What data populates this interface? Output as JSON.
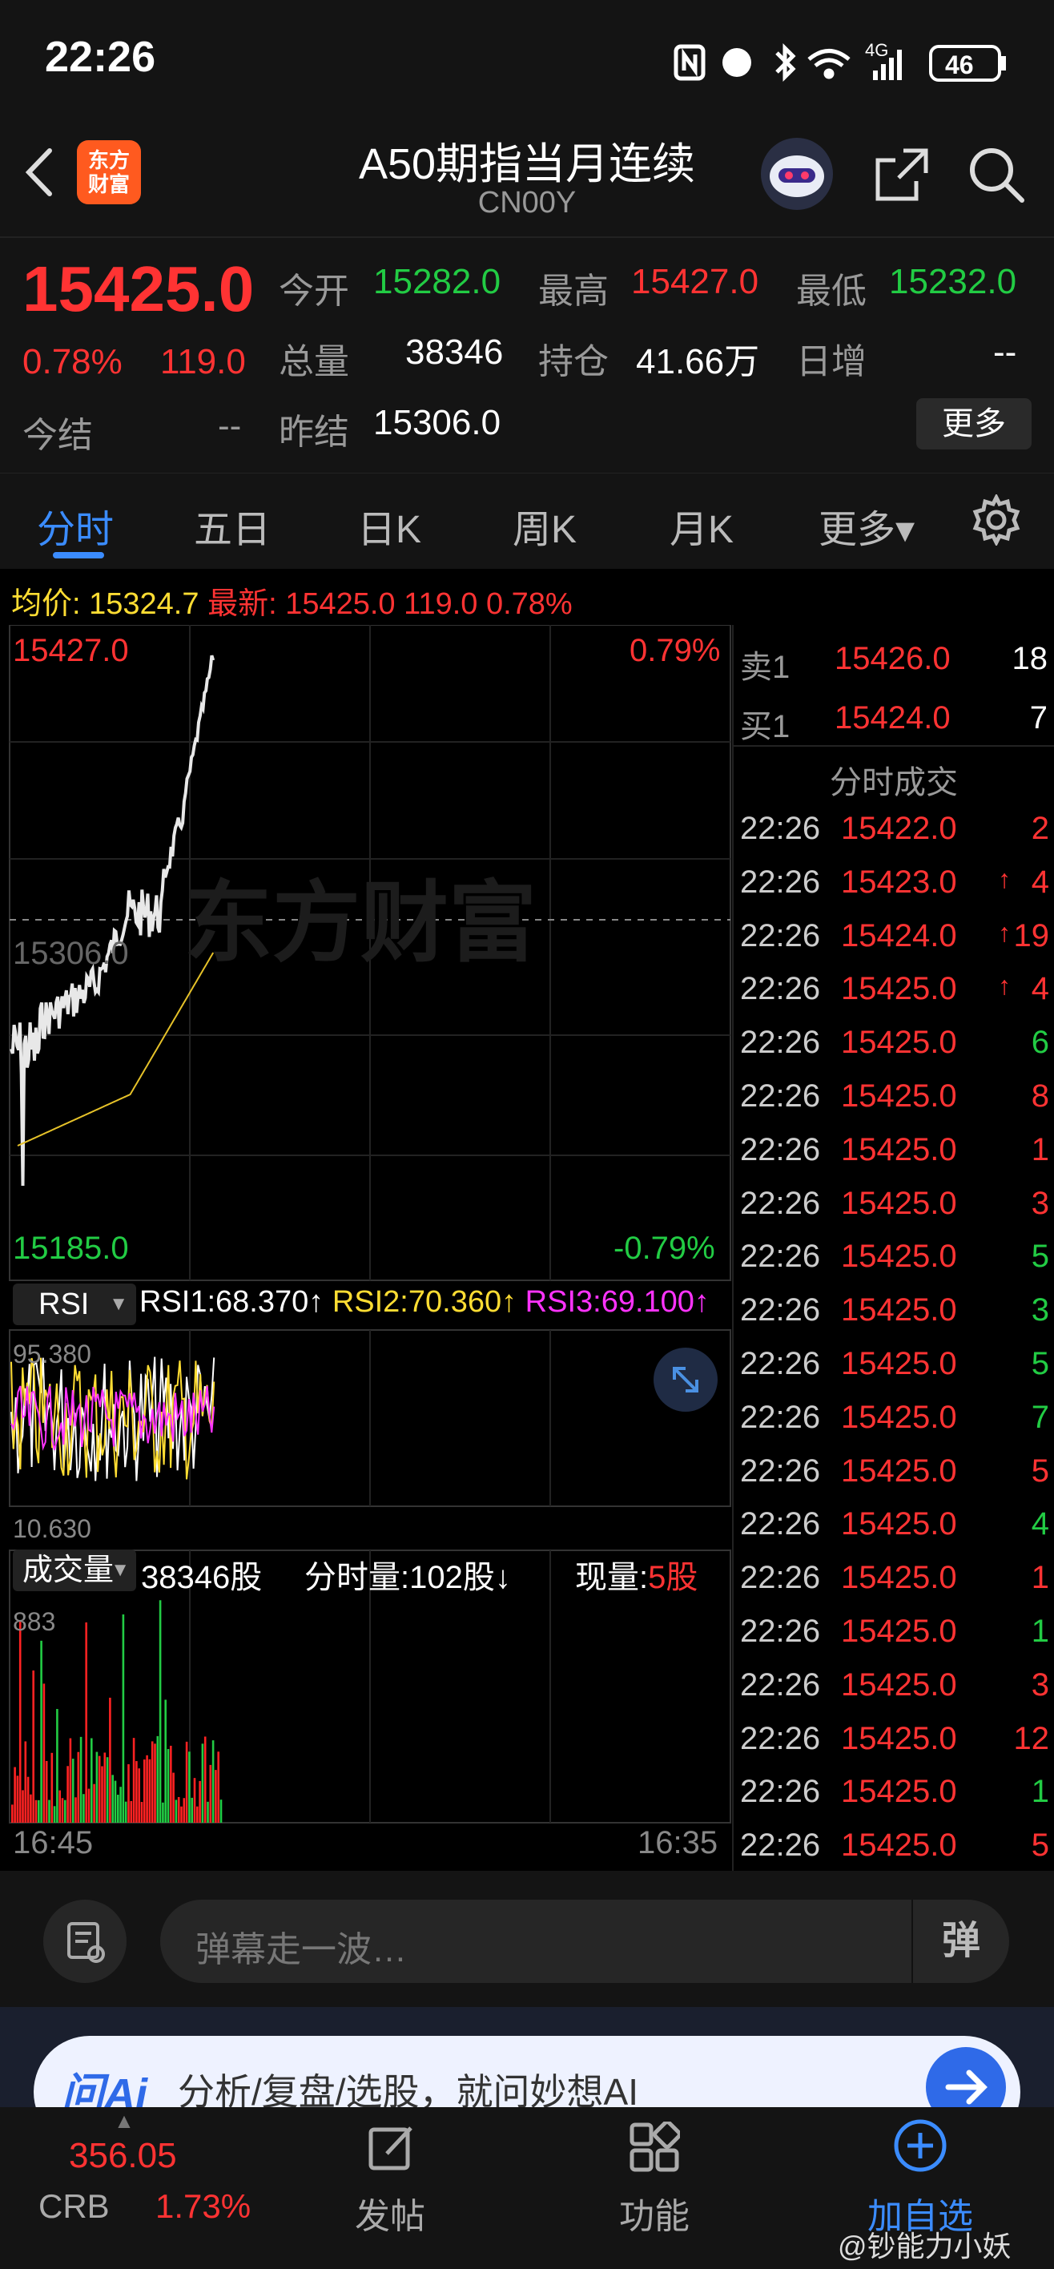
{
  "status_bar": {
    "time": "22:26",
    "battery": "46",
    "signal_label": "4G"
  },
  "header": {
    "logo_text": "东方\n财富",
    "title": "A50期指当月连续",
    "code": "CN00Y"
  },
  "quote": {
    "price": "15425.0",
    "change_pct": "0.78%",
    "change_abs": "119.0",
    "open_label": "今开",
    "open": "15282.0",
    "high_label": "最高",
    "high": "15427.0",
    "low_label": "最低",
    "low": "15232.0",
    "volume_label": "总量",
    "volume": "38346",
    "oi_label": "持仓",
    "oi": "41.66万",
    "daily_inc_label": "日增",
    "daily_inc": "--",
    "settle_label": "今结",
    "settle": "--",
    "prev_settle_label": "昨结",
    "prev_settle": "15306.0",
    "more_button": "更多"
  },
  "tabs": [
    {
      "label": "分时",
      "active": true
    },
    {
      "label": "五日",
      "active": false
    },
    {
      "label": "日K",
      "active": false
    },
    {
      "label": "周K",
      "active": false
    },
    {
      "label": "月K",
      "active": false
    },
    {
      "label": "更多▾",
      "active": false
    }
  ],
  "info_line": {
    "avg_label": "均价:",
    "avg": "15324.7",
    "latest_label": "最新:",
    "latest": "15425.0",
    "latest_chg": "119.0",
    "latest_pct": "0.78%"
  },
  "chart": {
    "top_price": "15427.0",
    "top_pct": "0.79%",
    "mid_price": "15306.0",
    "bottom_price": "15185.0",
    "bottom_pct": "-0.79%",
    "watermark": "东方财富",
    "start_time": "16:45",
    "end_time": "16:35"
  },
  "rsi": {
    "label": "RSI",
    "rsi1": "RSI1:68.370↑",
    "rsi2": "RSI2:70.360↑",
    "rsi3": "RSI3:69.100↑",
    "max": "95.380",
    "min": "10.630"
  },
  "volume_panel": {
    "label": "成交量",
    "total": "38346股",
    "minute": "分时量:102股↓",
    "current_label": "现量:",
    "current": "5股",
    "max": "883"
  },
  "orderbook": {
    "sell1_label": "卖1",
    "sell1_price": "15426.0",
    "sell1_qty": "18",
    "buy1_label": "买1",
    "buy1_price": "15424.0",
    "buy1_qty": "7",
    "trades_title": "分时成交"
  },
  "trades": [
    {
      "time": "22:26",
      "price": "15422.0",
      "qty": "2",
      "arrow": "",
      "qty_color": "#ff3333"
    },
    {
      "time": "22:26",
      "price": "15423.0",
      "qty": "4",
      "arrow": "↑",
      "qty_color": "#ff3333"
    },
    {
      "time": "22:26",
      "price": "15424.0",
      "qty": "19",
      "arrow": "↑",
      "qty_color": "#ff3333"
    },
    {
      "time": "22:26",
      "price": "15425.0",
      "qty": "4",
      "arrow": "↑",
      "qty_color": "#ff3333"
    },
    {
      "time": "22:26",
      "price": "15425.0",
      "qty": "6",
      "arrow": "",
      "qty_color": "#22cc44"
    },
    {
      "time": "22:26",
      "price": "15425.0",
      "qty": "8",
      "arrow": "",
      "qty_color": "#ff3333"
    },
    {
      "time": "22:26",
      "price": "15425.0",
      "qty": "1",
      "arrow": "",
      "qty_color": "#ff3333"
    },
    {
      "time": "22:26",
      "price": "15425.0",
      "qty": "3",
      "arrow": "",
      "qty_color": "#ff3333"
    },
    {
      "time": "22:26",
      "price": "15425.0",
      "qty": "5",
      "arrow": "",
      "qty_color": "#22cc44"
    },
    {
      "time": "22:26",
      "price": "15425.0",
      "qty": "3",
      "arrow": "",
      "qty_color": "#22cc44"
    },
    {
      "time": "22:26",
      "price": "15425.0",
      "qty": "5",
      "arrow": "",
      "qty_color": "#22cc44"
    },
    {
      "time": "22:26",
      "price": "15425.0",
      "qty": "7",
      "arrow": "",
      "qty_color": "#22cc44"
    },
    {
      "time": "22:26",
      "price": "15425.0",
      "qty": "5",
      "arrow": "",
      "qty_color": "#ff3333"
    },
    {
      "time": "22:26",
      "price": "15425.0",
      "qty": "4",
      "arrow": "",
      "qty_color": "#22cc44"
    },
    {
      "time": "22:26",
      "price": "15425.0",
      "qty": "1",
      "arrow": "",
      "qty_color": "#ff3333"
    },
    {
      "time": "22:26",
      "price": "15425.0",
      "qty": "1",
      "arrow": "",
      "qty_color": "#22cc44"
    },
    {
      "time": "22:26",
      "price": "15425.0",
      "qty": "3",
      "arrow": "",
      "qty_color": "#ff3333"
    },
    {
      "time": "22:26",
      "price": "15425.0",
      "qty": "12",
      "arrow": "",
      "qty_color": "#ff3333"
    },
    {
      "time": "22:26",
      "price": "15425.0",
      "qty": "1",
      "arrow": "",
      "qty_color": "#22cc44"
    },
    {
      "time": "22:26",
      "price": "15425.0",
      "qty": "5",
      "arrow": "",
      "qty_color": "#ff3333"
    }
  ],
  "danmu": {
    "placeholder": "弹幕走一波…",
    "send_icon_text": "弹"
  },
  "ai_bar": {
    "brand": "问Ai",
    "text": "分析/复盘/选股，就问妙想AI"
  },
  "bottom_nav": {
    "ticker_value": "356.05",
    "ticker_name": "CRB",
    "ticker_pct": "1.73%",
    "post_label": "发帖",
    "func_label": "功能",
    "add_label": "加自选"
  },
  "watermark_credit": "@钞能力小妖",
  "colors": {
    "up": "#ff3333",
    "down": "#22cc44",
    "accent": "#3b8cff",
    "avg_line": "#e6c229"
  }
}
